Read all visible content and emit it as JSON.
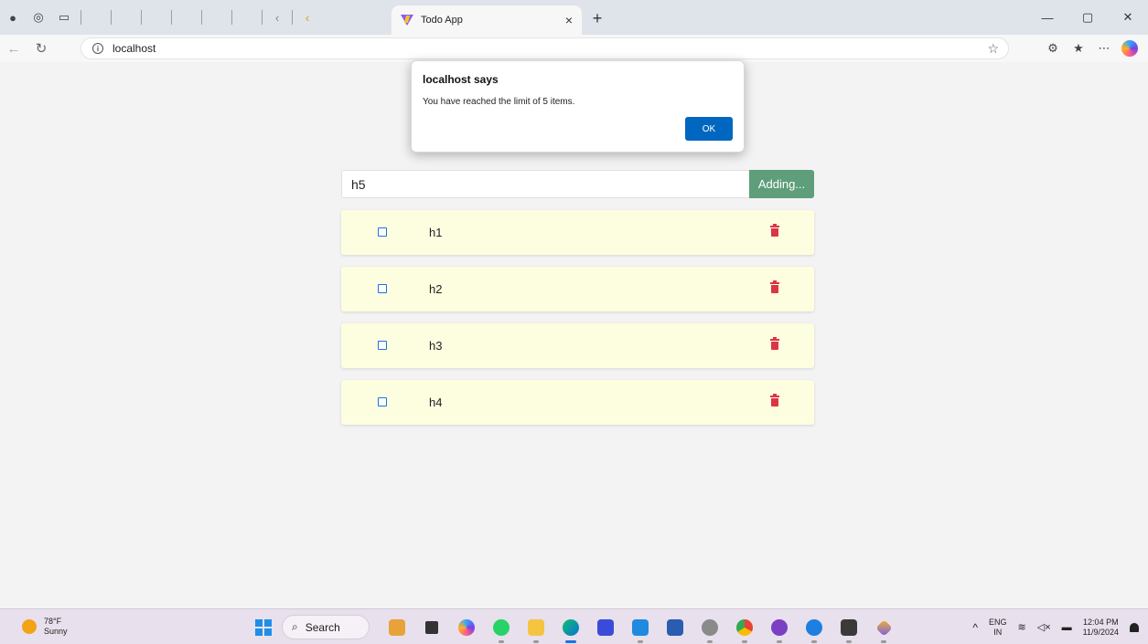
{
  "browser": {
    "tab_title": "Todo App",
    "tab_close": "×",
    "new_tab": "+",
    "url": "localhost",
    "window_controls": {
      "minimize": "—",
      "restore": "▢",
      "close": "✕"
    }
  },
  "todo": {
    "input_value": "h5",
    "add_button_label": "Adding...",
    "items": [
      {
        "text": "h1",
        "checked": false
      },
      {
        "text": "h2",
        "checked": false
      },
      {
        "text": "h3",
        "checked": false
      },
      {
        "text": "h4",
        "checked": false
      }
    ],
    "check_color": "#1a73e8",
    "delete_color": "#dc3545",
    "item_bg": "#fdfde0",
    "button_color": "#5e9e7a"
  },
  "alert": {
    "title": "localhost says",
    "message": "You have reached the limit of 5 items.",
    "ok_label": "OK"
  },
  "taskbar": {
    "temperature": "78°F",
    "condition": "Sunny",
    "search_label": "Search",
    "language": "ENG",
    "region": "IN",
    "time": "12:04 PM",
    "date": "11/9/2024"
  }
}
